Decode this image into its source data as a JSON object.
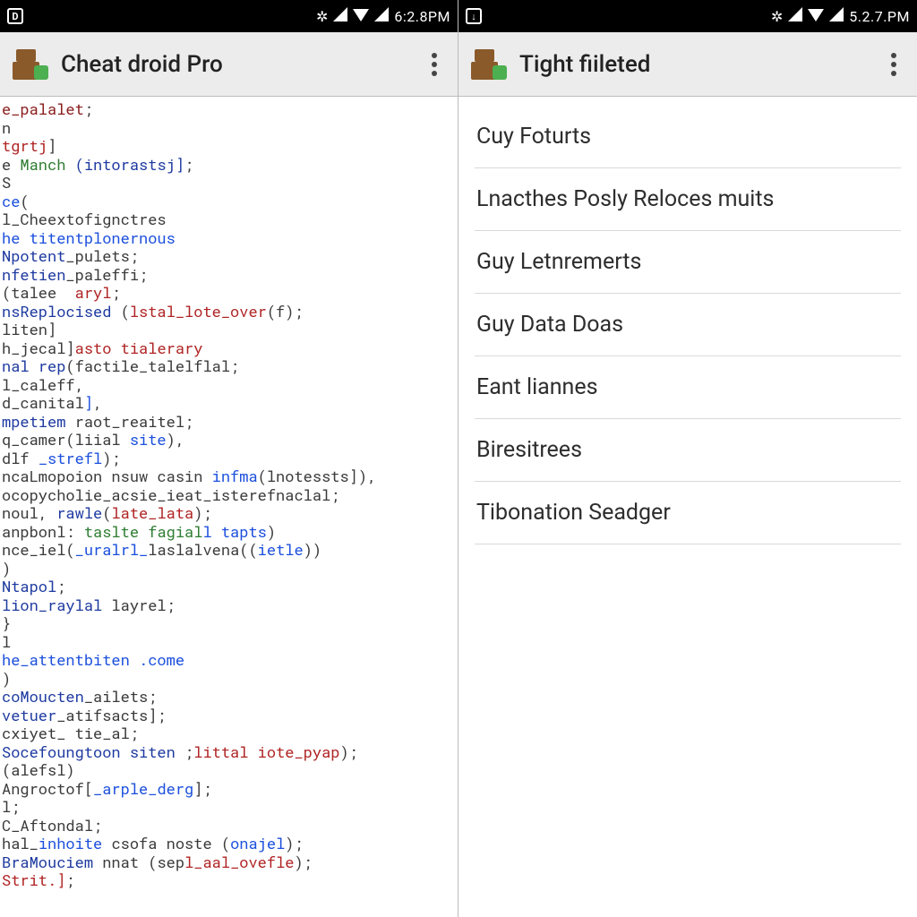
{
  "left": {
    "status": {
      "time": "6:2.8PM",
      "left_glyph": "D"
    },
    "title": "Cheat droid Pro",
    "icons": {
      "overflow": "overflow-icon",
      "app": "app-icon"
    },
    "code_lines": [
      [
        [
          "c-brown",
          "e_palalet"
        ],
        [
          "",
          ";"
        ]
      ],
      [
        [
          "",
          "n"
        ]
      ],
      [
        [
          "c-red",
          "tgrtj"
        ],
        [
          "",
          "]"
        ]
      ],
      [
        [
          "",
          "e "
        ],
        [
          "c-green",
          "Manch"
        ],
        [
          "c-dblue",
          " (intorastsj]"
        ],
        [
          "",
          ";"
        ]
      ],
      [
        [
          "",
          "S"
        ]
      ],
      [
        [
          "c-blue",
          "ce"
        ],
        [
          "",
          "("
        ]
      ],
      [
        [
          "",
          "l_Cheextofignctres"
        ]
      ],
      [
        [
          "c-blue",
          "he titentplonernous"
        ]
      ],
      [
        [
          "",
          ""
        ]
      ],
      [
        [
          "c-dblue",
          "Npotent"
        ],
        [
          "",
          "_pulets;"
        ]
      ],
      [
        [
          "c-dblue",
          "nfetien"
        ],
        [
          "",
          "_paleffi;"
        ]
      ],
      [
        [
          "",
          "(talee  "
        ],
        [
          "c-red",
          "aryl"
        ],
        [
          "",
          ";"
        ]
      ],
      [
        [
          "c-dblue",
          "nsReplocised "
        ],
        [
          "",
          "("
        ],
        [
          "c-red",
          "lstal_lote_over"
        ],
        [
          "",
          "(f);"
        ]
      ],
      [
        [
          "",
          "liten]"
        ]
      ],
      [
        [
          "",
          "h_jecal]"
        ],
        [
          "c-red",
          "asto tialerary"
        ]
      ],
      [
        [
          "c-dblue",
          "nal rep"
        ],
        [
          "",
          "(factile_talelflal;"
        ]
      ],
      [
        [
          "",
          "l_caleff,"
        ]
      ],
      [
        [
          "",
          "d_canital"
        ],
        [
          "c-blue",
          "]"
        ],
        [
          "",
          ","
        ]
      ],
      [
        [
          "c-dblue",
          "mpetiem "
        ],
        [
          "",
          "raot_reaitel;"
        ]
      ],
      [
        [
          "",
          "q_camer(liial "
        ],
        [
          "c-blue",
          "site"
        ],
        [
          "",
          "),"
        ]
      ],
      [
        [
          "",
          "dlf "
        ],
        [
          "c-blue",
          "_strefl"
        ],
        [
          "",
          ");"
        ]
      ],
      [
        [
          "",
          "ncaLmopoion nsuw casin "
        ],
        [
          "c-blue",
          "infma"
        ],
        [
          "",
          "(lnotessts]),"
        ]
      ],
      [
        [
          "",
          "ocopycholie_acsie_ieat_isterefnaclal;"
        ]
      ],
      [
        [
          "",
          "noul, "
        ],
        [
          "c-dblue",
          "rawle"
        ],
        [
          "",
          "("
        ],
        [
          "c-red",
          "late_lata"
        ],
        [
          "",
          ");"
        ]
      ],
      [
        [
          "",
          "anpbonl: "
        ],
        [
          "c-green",
          "taslte fagial"
        ],
        [
          "c-blue",
          "l tapts"
        ],
        [
          "",
          ")"
        ]
      ],
      [
        [
          "",
          "nce_iel("
        ],
        [
          "c-blue",
          "_uralrl_"
        ],
        [
          "",
          "laslalvena(("
        ],
        [
          "c-blue",
          "ietle"
        ],
        [
          "",
          "))"
        ]
      ],
      [
        [
          "",
          ")"
        ]
      ],
      [
        [
          "c-dblue",
          "Ntapol"
        ],
        [
          "",
          ";"
        ]
      ],
      [
        [
          "c-dblue",
          "lion_raylal "
        ],
        [
          "",
          "layrel;"
        ]
      ],
      [
        [
          "",
          "}"
        ]
      ],
      [
        [
          "",
          "l"
        ]
      ],
      [
        [
          "c-blue",
          "he_attentbiten .come"
        ]
      ],
      [
        [
          "",
          ")"
        ]
      ],
      [
        [
          "c-dblue",
          "coMoucten"
        ],
        [
          "",
          "_ailets;"
        ]
      ],
      [
        [
          "c-dblue",
          "vetuer"
        ],
        [
          "",
          "_atifsacts];"
        ]
      ],
      [
        [
          "",
          "cxiyet_ tie_al;"
        ]
      ],
      [
        [
          "c-dblue",
          "Socefoungtoon siten "
        ],
        [
          "",
          ";"
        ],
        [
          "c-red",
          "littal iote_pyap"
        ],
        [
          "",
          ");"
        ]
      ],
      [
        [
          "",
          "(alefsl)"
        ]
      ],
      [
        [
          "",
          "Angroctof["
        ],
        [
          "c-blue",
          "_arple_derg"
        ],
        [
          "",
          "];"
        ]
      ],
      [
        [
          "",
          "l;"
        ]
      ],
      [
        [
          "",
          "C_Aftondal;"
        ]
      ],
      [
        [
          "",
          "hal_"
        ],
        [
          "c-blue",
          "inhoite "
        ],
        [
          "",
          "csofa noste ("
        ],
        [
          "c-blue",
          "onajel"
        ],
        [
          "",
          ");"
        ]
      ],
      [
        [
          "c-dblue",
          "BraMouciem"
        ],
        [
          "",
          " nnat (sep"
        ],
        [
          "c-red",
          "l_aal_ovefle"
        ],
        [
          "",
          ");"
        ]
      ],
      [
        [
          "c-red",
          "Strit.]"
        ],
        [
          "",
          ";"
        ]
      ]
    ]
  },
  "right": {
    "status": {
      "time": "5.2.7.PM",
      "left_glyph": "↓"
    },
    "title": "Tight fiileted",
    "items": [
      "Cuy Foturts",
      "Lnacthes Posly Reloces muits",
      "Guy Letnremerts",
      "Guy Data Doas",
      "Eant liannes",
      "Biresitrees",
      "Tibonation Seadger"
    ]
  },
  "status_icons": {
    "gear": "gear-icon",
    "signal": "signal-icon",
    "wifi": "wifi-icon"
  }
}
